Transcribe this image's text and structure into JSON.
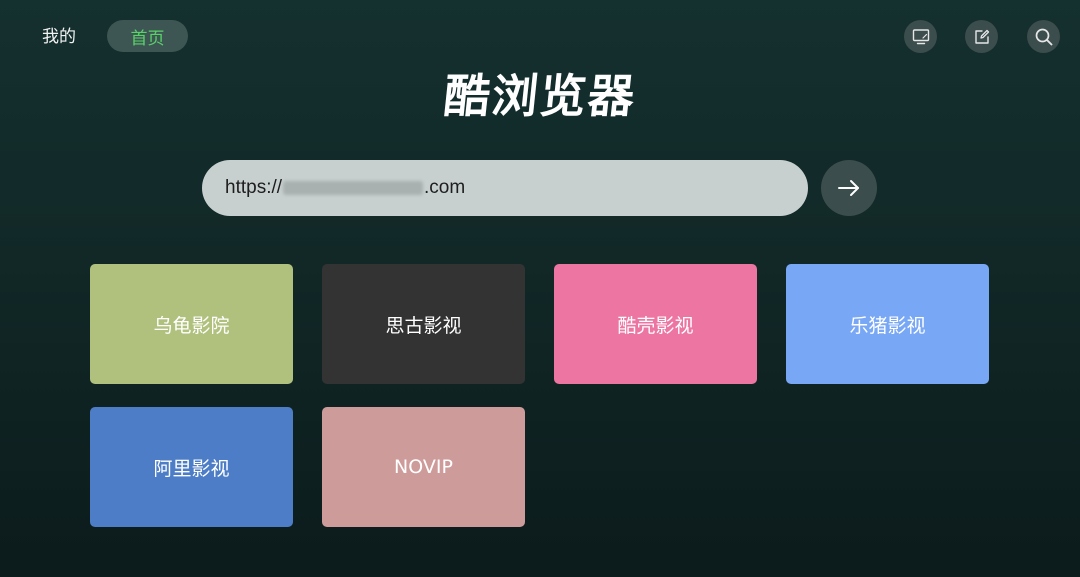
{
  "nav": {
    "mine_label": "我的",
    "home_label": "首页",
    "home_color": "#5ad26a"
  },
  "toolbar": {
    "icons": [
      "cast-screen-icon",
      "edit-icon",
      "search-icon"
    ]
  },
  "app": {
    "title": "酷浏览器"
  },
  "url_bar": {
    "prefix": "https://",
    "suffix": ".com",
    "go_icon": "arrow-right-icon"
  },
  "tiles": [
    {
      "label": "乌龟影院",
      "color": "#b0c17d"
    },
    {
      "label": "思古影视",
      "color": "#333333"
    },
    {
      "label": "酷壳影视",
      "color": "#ec75a1"
    },
    {
      "label": "乐猪影视",
      "color": "#78a7f5"
    },
    {
      "label": "阿里影视",
      "color": "#4c7dc6"
    },
    {
      "label": "NOVIP",
      "color": "#ce9b9b"
    }
  ]
}
